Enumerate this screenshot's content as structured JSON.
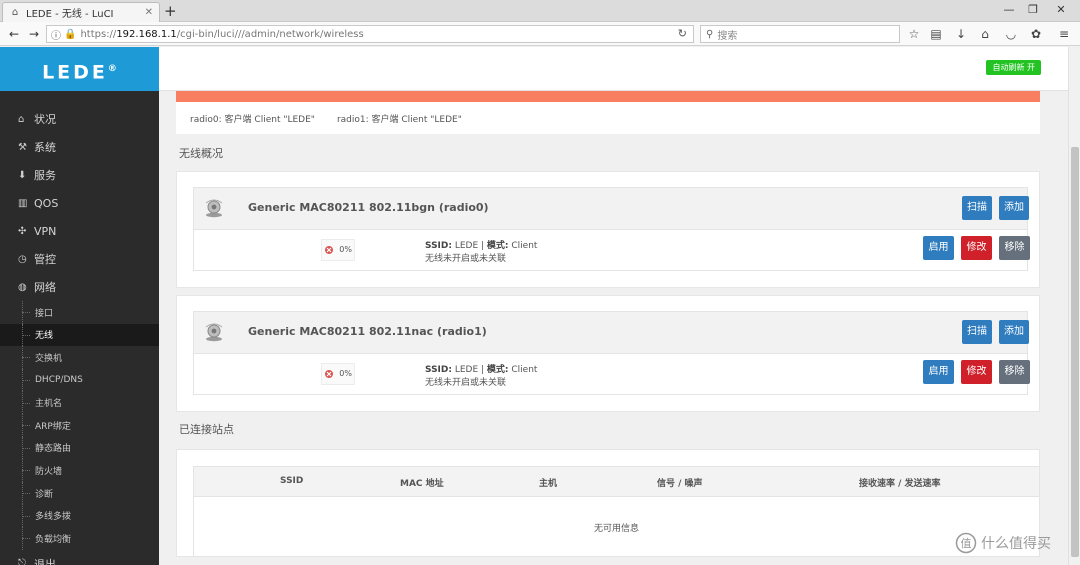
{
  "browser": {
    "tab_title": "LEDE - 无线 - LuCI",
    "url_proto": "https://",
    "url_host": "192.168.1.1",
    "url_path": "/cgi-bin/luci///admin/network/wireless",
    "search_placeholder": "搜索"
  },
  "sidebar": {
    "logo": "LEDE",
    "logo_mark": "®",
    "menu": [
      {
        "label": "状况",
        "icon": "home-icon"
      },
      {
        "label": "系统",
        "icon": "tools-icon"
      },
      {
        "label": "服务",
        "icon": "download-icon"
      },
      {
        "label": "QOS",
        "icon": "bar-chart-icon"
      },
      {
        "label": "VPN",
        "icon": "network-icon"
      },
      {
        "label": "管控",
        "icon": "clock-icon"
      },
      {
        "label": "网络",
        "icon": "globe-icon"
      }
    ],
    "submenu": [
      "接口",
      "无线",
      "交换机",
      "DHCP/DNS",
      "主机名",
      "ARP绑定",
      "静态路由",
      "防火墙",
      "诊断",
      "多线多拨",
      "负载均衡"
    ],
    "logout": "退出"
  },
  "header": {
    "auto_refresh": "自动刷新 开"
  },
  "radio_status": {
    "radio0": "radio0: 客户端 Client \"LEDE\"",
    "radio1": "radio1: 客户端 Client \"LEDE\""
  },
  "wireless_overview": {
    "title": "无线概况",
    "devices": [
      {
        "name": "Generic MAC80211 802.11bgn (radio0)",
        "scan": "扫描",
        "add": "添加",
        "signal": "0%",
        "ssid_label": "SSID:",
        "ssid_value": " LEDE | ",
        "mode_label": "模式:",
        "mode_value": " Client",
        "status": "无线未开启或未关联",
        "enable": "启用",
        "edit": "修改",
        "remove": "移除"
      },
      {
        "name": "Generic MAC80211 802.11nac (radio1)",
        "scan": "扫描",
        "add": "添加",
        "signal": "0%",
        "ssid_label": "SSID:",
        "ssid_value": " LEDE | ",
        "mode_label": "模式:",
        "mode_value": " Client",
        "status": "无线未开启或未关联",
        "enable": "启用",
        "edit": "修改",
        "remove": "移除"
      }
    ]
  },
  "stations": {
    "title": "已连接站点",
    "columns": [
      "SSID",
      "MAC 地址",
      "主机",
      "信号 / 噪声",
      "接收速率 / 发送速率"
    ],
    "empty": "无可用信息"
  },
  "watermark": "什么值得买",
  "colors": {
    "accent": "#1e9bd7",
    "sidebar_bg": "#2b2b2b",
    "alert": "#f87f61",
    "btn_blue": "#2f7cbe",
    "btn_red": "#d0202a",
    "btn_gray": "#66707c",
    "refresh_green": "#22c322"
  }
}
